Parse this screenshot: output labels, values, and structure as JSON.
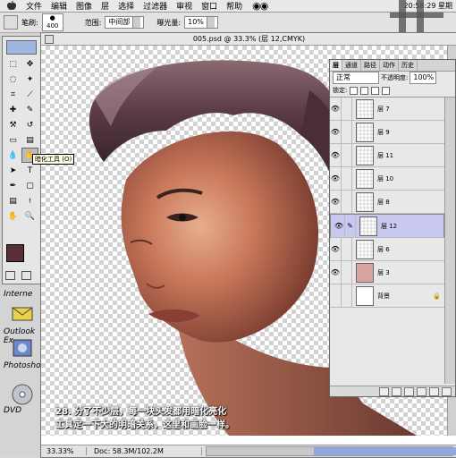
{
  "menubar": {
    "items": [
      "文件",
      "编辑",
      "图像",
      "层",
      "选择",
      "过滤器",
      "审视",
      "窗口",
      "帮助"
    ],
    "clock": "20:58:29 星期"
  },
  "options": {
    "tool_label": "笔刷:",
    "brush_size": "400",
    "range_label": "范围:",
    "range_value": "中间部",
    "exposure_label": "曝光量:",
    "exposure_value": "10%"
  },
  "document": {
    "title": "005.psd @ 33.3% (层 12,CMYK)",
    "zoom": "33.33%",
    "doc_size": "Doc: 58.3M/102.2M",
    "caption_line1": "28. 分了不少层，每一块头发都用暗化亮化",
    "caption_line2": "工具定一下大的明暗关系，这里和画脸一样。"
  },
  "tooltip": "暗化工具 (O)",
  "desktop_icons": [
    "Interne",
    "Outlook Ex",
    "Photosho",
    "DVD"
  ],
  "layers": {
    "tabs": [
      "层",
      "通道",
      "路径",
      "动作",
      "历史"
    ],
    "mode": "正常",
    "opacity_label": "不透明度:",
    "opacity_value": "100%",
    "lock_label": "锁定:",
    "items": [
      {
        "name": "层 7",
        "visible": true,
        "selected": false
      },
      {
        "name": "层 9",
        "visible": true,
        "selected": false
      },
      {
        "name": "层 11",
        "visible": true,
        "selected": false
      },
      {
        "name": "层 10",
        "visible": true,
        "selected": false
      },
      {
        "name": "层 8",
        "visible": true,
        "selected": false
      },
      {
        "name": "层 12",
        "visible": true,
        "selected": true
      },
      {
        "name": "层 6",
        "visible": true,
        "selected": false
      },
      {
        "name": "层 3",
        "visible": true,
        "selected": false
      },
      {
        "name": "背景",
        "visible": false,
        "selected": false
      }
    ]
  },
  "colors": {
    "foreground": "#5a3038",
    "background": "#ffffff",
    "selection": "#c8c8f0"
  }
}
